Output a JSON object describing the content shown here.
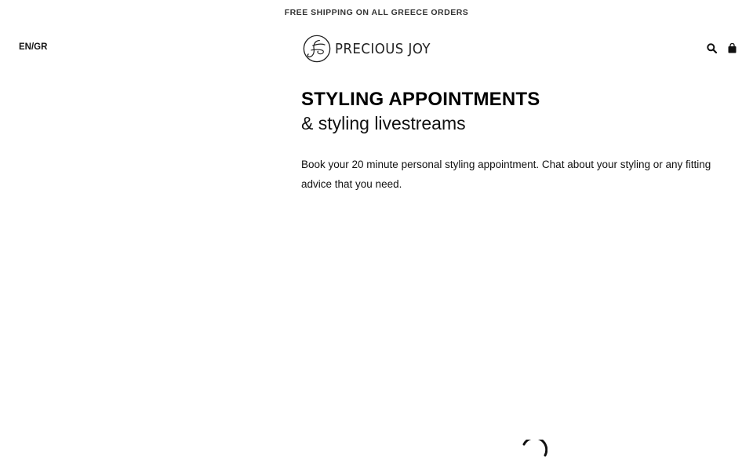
{
  "announcement": {
    "text": "FREE SHIPPING ON ALL GREECE ORDERS"
  },
  "header": {
    "language_switcher": "EN/GR",
    "logo_text": "PRECIOUS JOY",
    "icons": {
      "search": "search-icon",
      "cart": "shopping-bag-icon"
    }
  },
  "main": {
    "title": "STYLING APPOINTMENTS",
    "subtitle": "& styling livestreams",
    "description": "Book your 20 minute personal styling appointment. Chat about your styling or any fitting advice that you need."
  },
  "loading": {
    "icon": "loading-spinner-icon"
  },
  "colors": {
    "text": "#111111",
    "background": "#ffffff"
  }
}
